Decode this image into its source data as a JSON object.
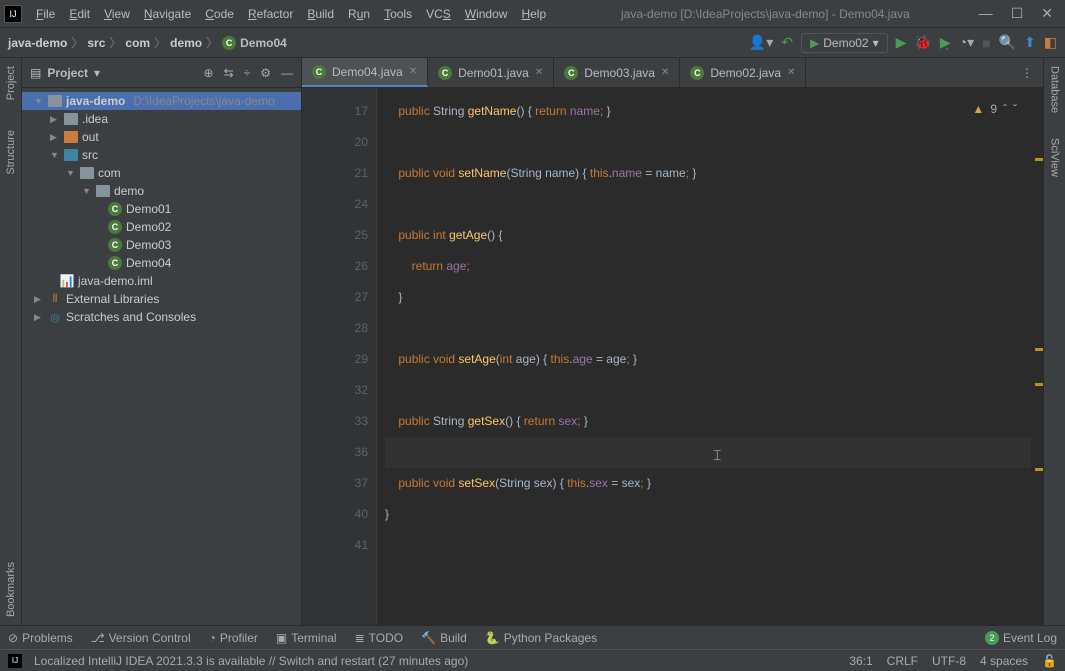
{
  "window": {
    "title": "java-demo [D:\\IdeaProjects\\java-demo] - Demo04.java"
  },
  "menu": {
    "file": "File",
    "edit": "Edit",
    "view": "View",
    "navigate": "Navigate",
    "code": "Code",
    "refactor": "Refactor",
    "build": "Build",
    "run": "Run",
    "tools": "Tools",
    "vcs": "VCS",
    "window": "Window",
    "help": "Help"
  },
  "breadcrumb": {
    "project": "java-demo",
    "src": "src",
    "com": "com",
    "demo": "demo",
    "klass": "Demo04"
  },
  "run_config": "Demo02",
  "left_tabs": {
    "project": "Project",
    "structure": "Structure",
    "bookmarks": "Bookmarks"
  },
  "right_tabs": {
    "database": "Database",
    "sciview": "SciView"
  },
  "project_panel": {
    "title": "Project",
    "root": "java-demo",
    "root_path": "D:\\IdeaProjects\\java-demo",
    "idea": ".idea",
    "out": "out",
    "src": "src",
    "com": "com",
    "demo": "demo",
    "d1": "Demo01",
    "d2": "Demo02",
    "d3": "Demo03",
    "d4": "Demo04",
    "iml": "java-demo.iml",
    "ext": "External Libraries",
    "scratch": "Scratches and Consoles"
  },
  "tabs": [
    {
      "label": "Demo04.java",
      "active": true
    },
    {
      "label": "Demo01.java",
      "active": false
    },
    {
      "label": "Demo03.java",
      "active": false
    },
    {
      "label": "Demo02.java",
      "active": false
    }
  ],
  "editor": {
    "warnings": "9",
    "line_numbers": [
      "17",
      "20",
      "21",
      "24",
      "25",
      "26",
      "27",
      "28",
      "29",
      "32",
      "33",
      "36",
      "37",
      "40",
      "41"
    ]
  },
  "bottom": {
    "problems": "Problems",
    "version": "Version Control",
    "profiler": "Profiler",
    "terminal": "Terminal",
    "todo": "TODO",
    "build": "Build",
    "python": "Python Packages",
    "eventlog": "Event Log",
    "event_count": "2"
  },
  "status": {
    "msg": "Localized IntelliJ IDEA 2021.3.3 is available // Switch and restart (27 minutes ago)",
    "pos": "36:1",
    "sep": "CRLF",
    "enc": "UTF-8",
    "indent": "4 spaces"
  }
}
